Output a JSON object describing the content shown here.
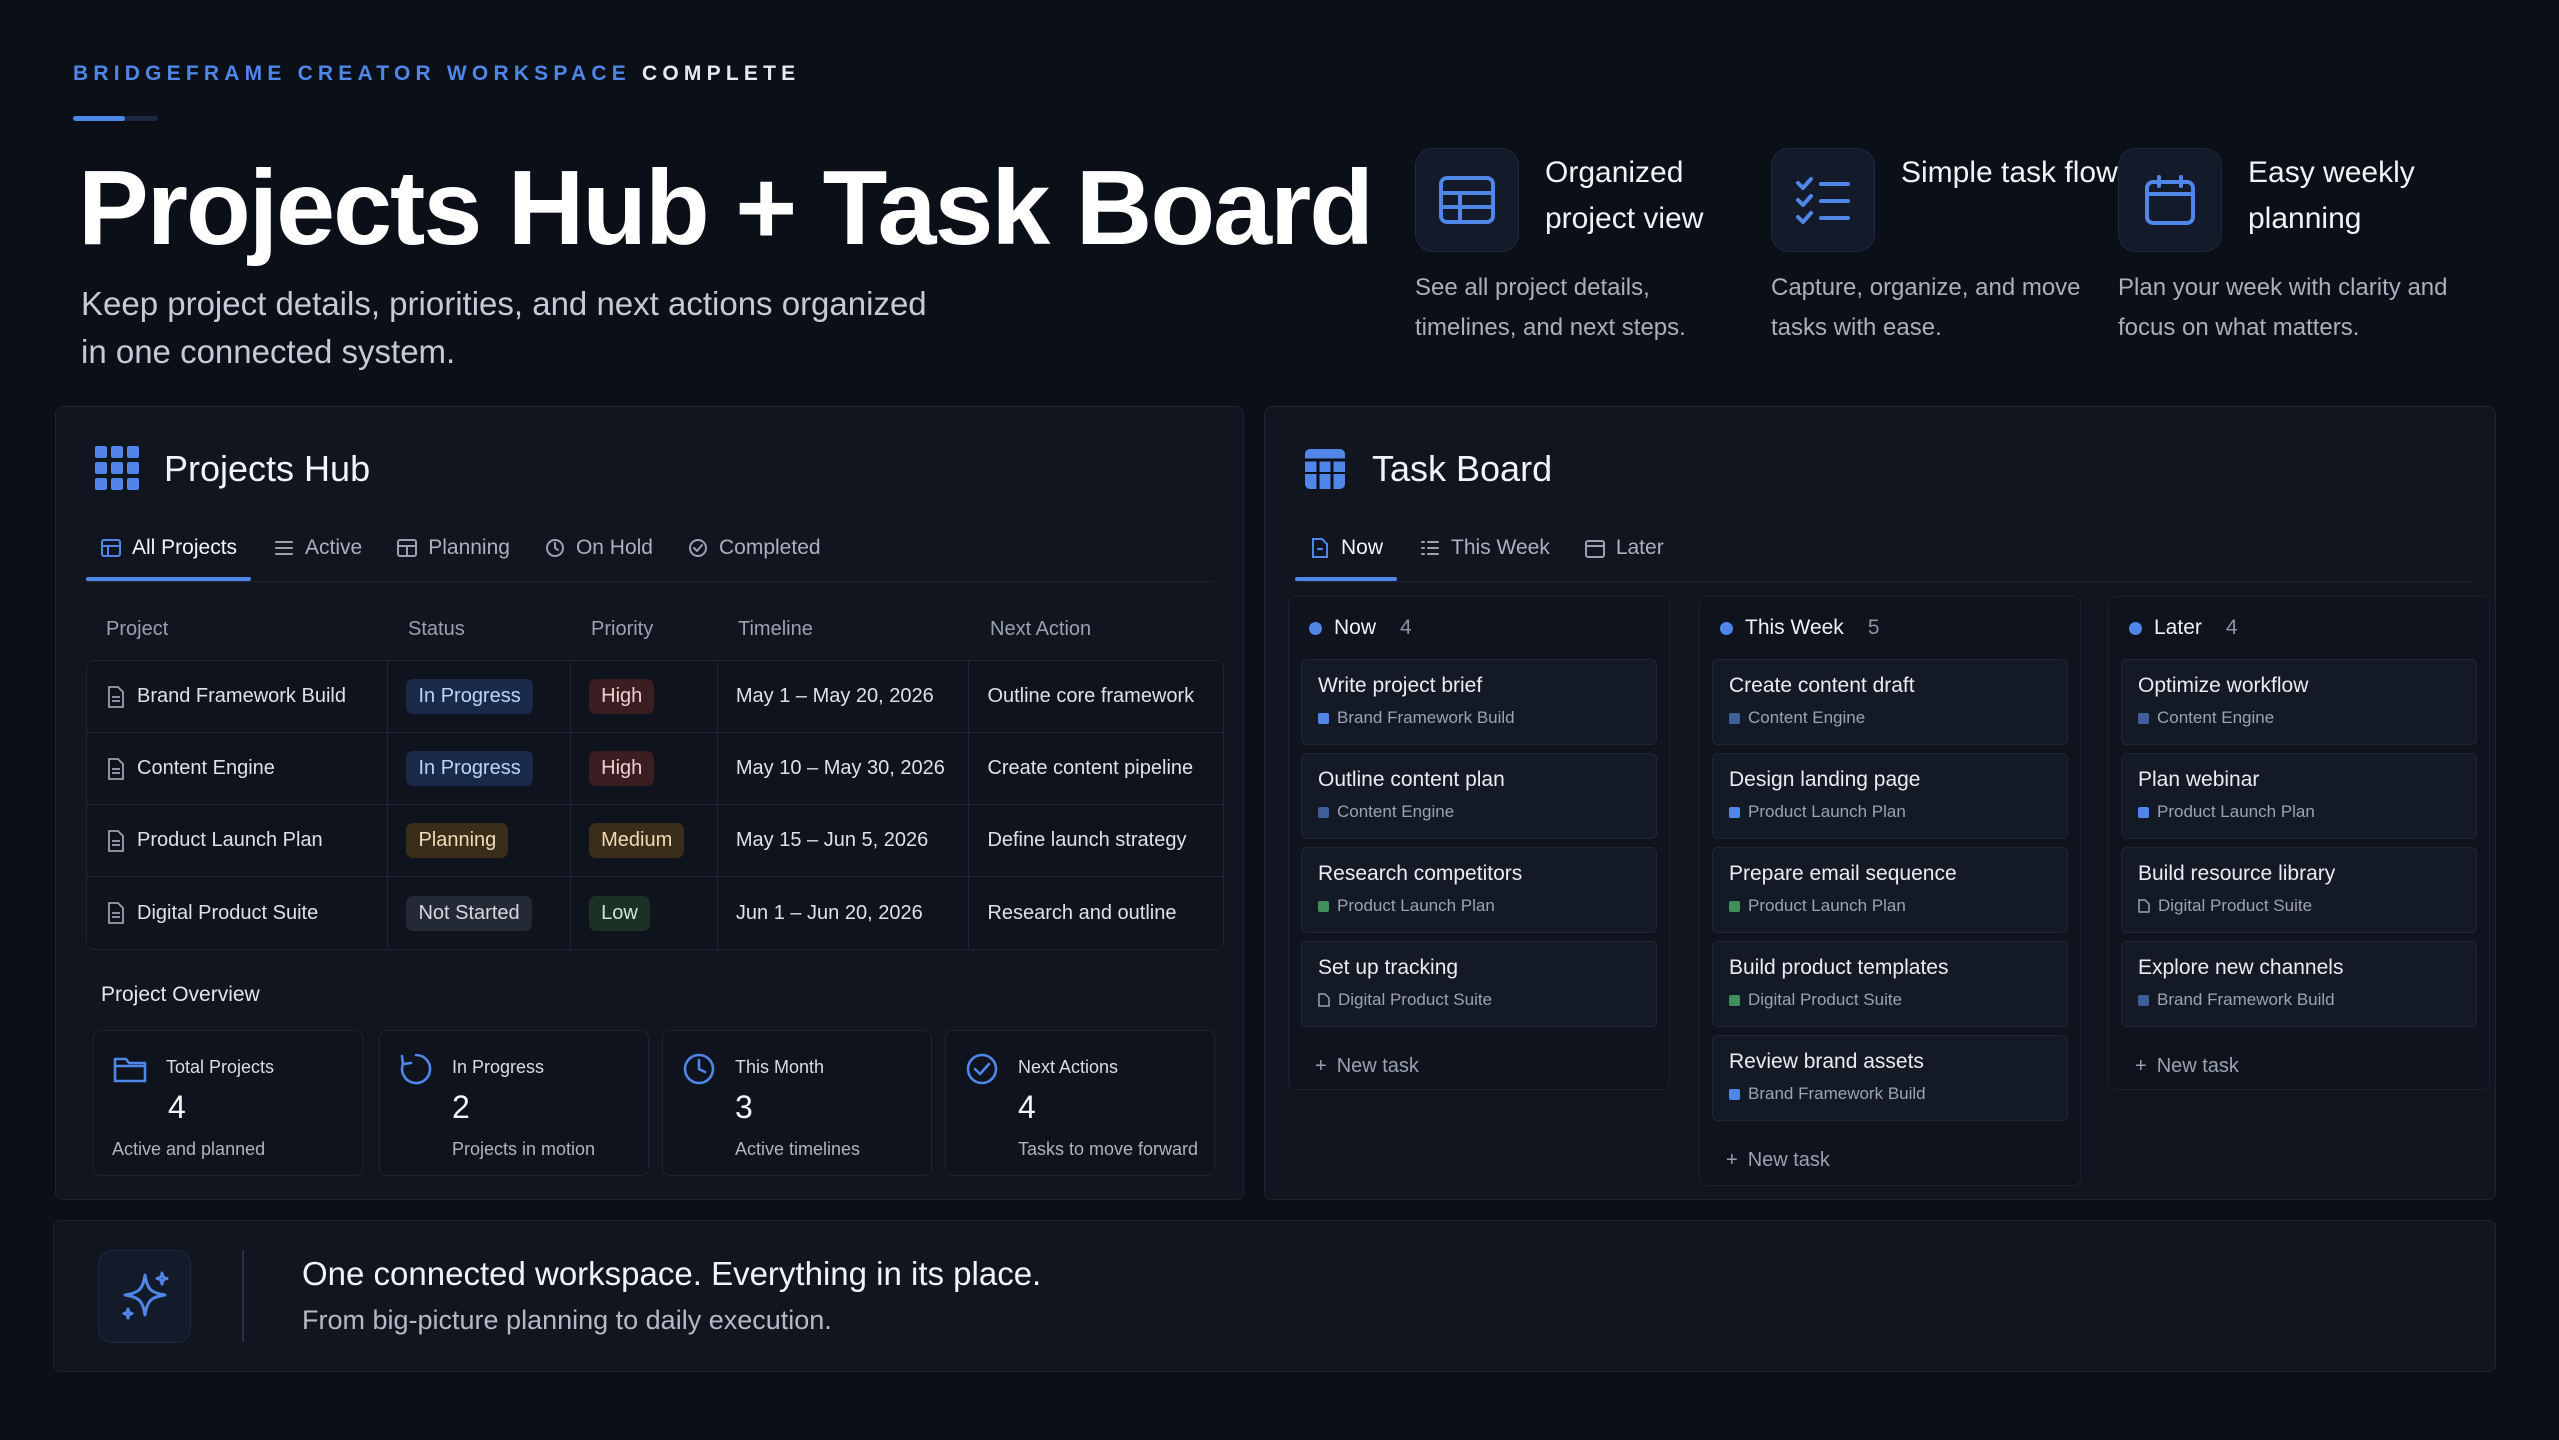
{
  "header": {
    "eyebrow_accent": "BRIDGEFRAME CREATOR WORKSPACE",
    "eyebrow_tail": "COMPLETE",
    "title": "Projects Hub + Task Board",
    "subtitle": "Keep project details, priorities, and next actions organized in one connected system."
  },
  "features": [
    {
      "title": "Organized project view",
      "desc": "See all project details, timelines, and next steps.",
      "icon": "table-icon"
    },
    {
      "title": "Simple task flow",
      "desc": "Capture, organize, and move tasks with ease.",
      "icon": "checklist-icon"
    },
    {
      "title": "Easy weekly planning",
      "desc": "Plan your week with clarity and focus on what matters.",
      "icon": "calendar-icon"
    }
  ],
  "projects_hub": {
    "title": "Projects Hub",
    "tabs": [
      {
        "label": "All Projects",
        "active": true
      },
      {
        "label": "Active"
      },
      {
        "label": "Planning"
      },
      {
        "label": "On Hold"
      },
      {
        "label": "Completed"
      }
    ],
    "columns": [
      "Project",
      "Status",
      "Priority",
      "Timeline",
      "Next Action"
    ],
    "rows": [
      {
        "project": "Brand Framework Build",
        "status": "In Progress",
        "priority": "High",
        "timeline": "May 1 – May 20, 2026",
        "next": "Outline core framework"
      },
      {
        "project": "Content Engine",
        "status": "In Progress",
        "priority": "High",
        "timeline": "May 10 – May 30, 2026",
        "next": "Create content pipeline"
      },
      {
        "project": "Product Launch Plan",
        "status": "Planning",
        "priority": "Medium",
        "timeline": "May 15 – Jun 5, 2026",
        "next": "Define launch strategy"
      },
      {
        "project": "Digital Product Suite",
        "status": "Not Started",
        "priority": "Low",
        "timeline": "Jun 1 – Jun 20, 2026",
        "next": "Research and outline"
      }
    ],
    "overview_label": "Project Overview",
    "overview": [
      {
        "title": "Total Projects",
        "value": "4",
        "sub": "Active and planned"
      },
      {
        "title": "In Progress",
        "value": "2",
        "sub": "Projects in motion"
      },
      {
        "title": "This Month",
        "value": "3",
        "sub": "Active timelines"
      },
      {
        "title": "Next Actions",
        "value": "4",
        "sub": "Tasks to move forward"
      }
    ]
  },
  "task_board": {
    "title": "Task Board",
    "tabs": [
      {
        "label": "Now",
        "active": true
      },
      {
        "label": "This Week"
      },
      {
        "label": "Later"
      }
    ],
    "new_task": "New task",
    "columns": [
      {
        "name": "Now",
        "count": "4",
        "cards": [
          {
            "title": "Write project brief",
            "project": "Brand Framework Build",
            "color": "#4f86e8"
          },
          {
            "title": "Outline content plan",
            "project": "Content Engine",
            "color": "#3f5f9a"
          },
          {
            "title": "Research competitors",
            "project": "Product Launch Plan",
            "color": "#3f8f5a"
          },
          {
            "title": "Set up tracking",
            "project": "Digital Product Suite",
            "color": "doc"
          }
        ]
      },
      {
        "name": "This Week",
        "count": "5",
        "cards": [
          {
            "title": "Create content draft",
            "project": "Content Engine",
            "color": "#3f5f9a"
          },
          {
            "title": "Design landing page",
            "project": "Product Launch Plan",
            "color": "#4f86e8"
          },
          {
            "title": "Prepare email sequence",
            "project": "Product Launch Plan",
            "color": "#3f8f5a"
          },
          {
            "title": "Build product templates",
            "project": "Digital Product Suite",
            "color": "#3f8f5a"
          },
          {
            "title": "Review brand assets",
            "project": "Brand Framework Build",
            "color": "#4f86e8"
          }
        ]
      },
      {
        "name": "Later",
        "count": "4",
        "cards": [
          {
            "title": "Optimize workflow",
            "project": "Content Engine",
            "color": "#3f5f9a"
          },
          {
            "title": "Plan webinar",
            "project": "Product Launch Plan",
            "color": "#4f86e8"
          },
          {
            "title": "Build resource library",
            "project": "Digital Product Suite",
            "color": "doc"
          },
          {
            "title": "Explore new channels",
            "project": "Brand Framework Build",
            "color": "#3f5f9a"
          }
        ]
      }
    ]
  },
  "footer": {
    "title": "One connected workspace. Everything in its place.",
    "subtitle": "From big-picture planning to daily execution."
  },
  "colors": {
    "accent": "#4f86e8",
    "background": "#0b0f17",
    "panel": "#101520"
  }
}
